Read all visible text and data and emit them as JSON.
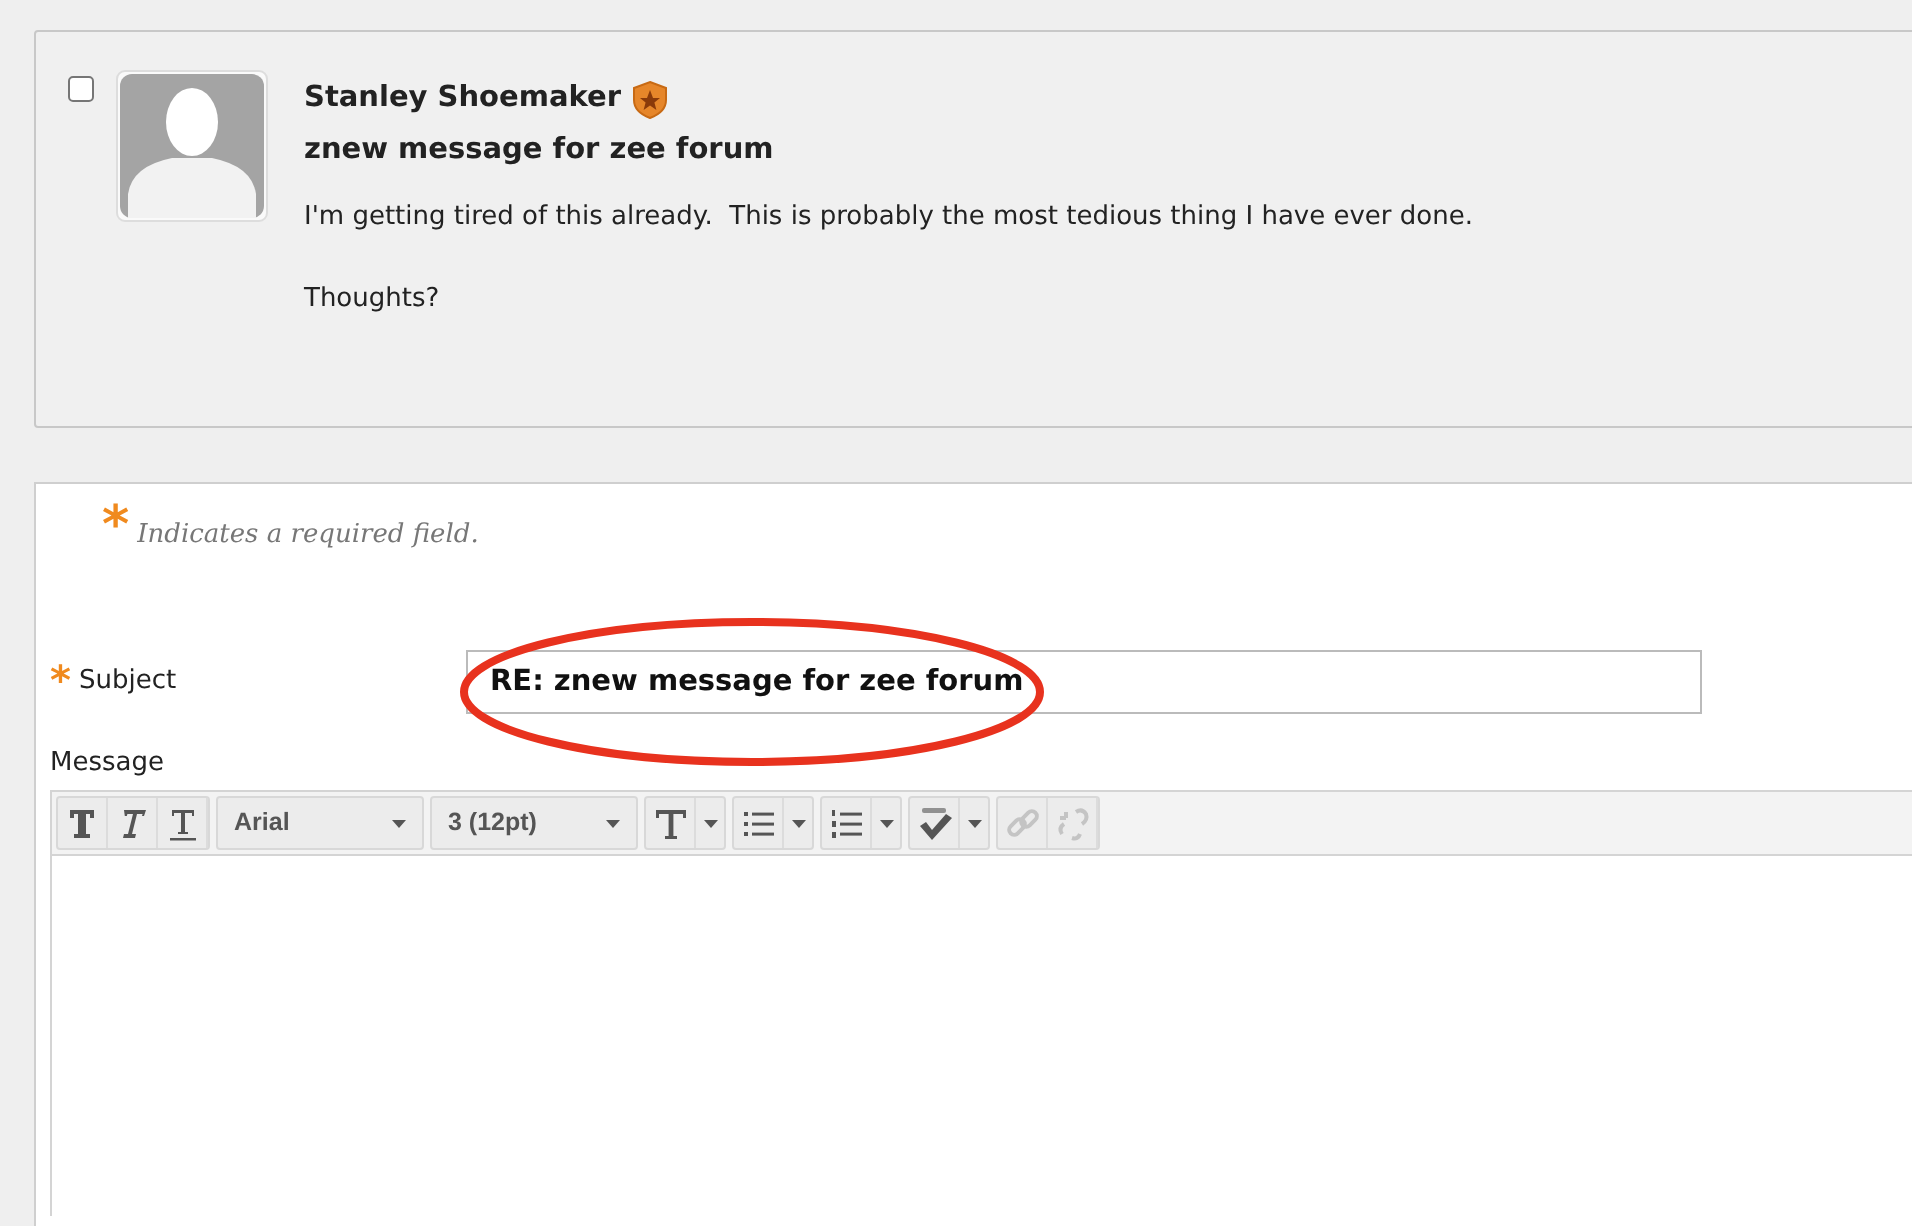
{
  "post": {
    "checked": false,
    "author": "Stanley Shoemaker",
    "title": "znew message for zee forum",
    "paragraphs": [
      "I'm getting tired of this already.  This is probably the most tedious thing I have ever done.",
      "Thoughts?"
    ]
  },
  "form": {
    "required_marker": "*",
    "required_note": "Indicates a required field.",
    "subject": {
      "marker": "*",
      "label": "Subject",
      "value": "RE: znew message for zee forum"
    },
    "message_label": "Message",
    "toolbar": [
      {
        "kind": "bold"
      },
      {
        "kind": "italic"
      },
      {
        "kind": "underline"
      },
      {
        "kind": "select",
        "value": "Arial"
      },
      {
        "kind": "select",
        "value": "3 (12pt)"
      },
      {
        "kind": "text-color"
      },
      {
        "kind": "bullet-list"
      },
      {
        "kind": "numbered-list"
      },
      {
        "kind": "spellcheck"
      },
      {
        "kind": "link",
        "disabled": true
      },
      {
        "kind": "unlink",
        "disabled": true
      }
    ]
  }
}
